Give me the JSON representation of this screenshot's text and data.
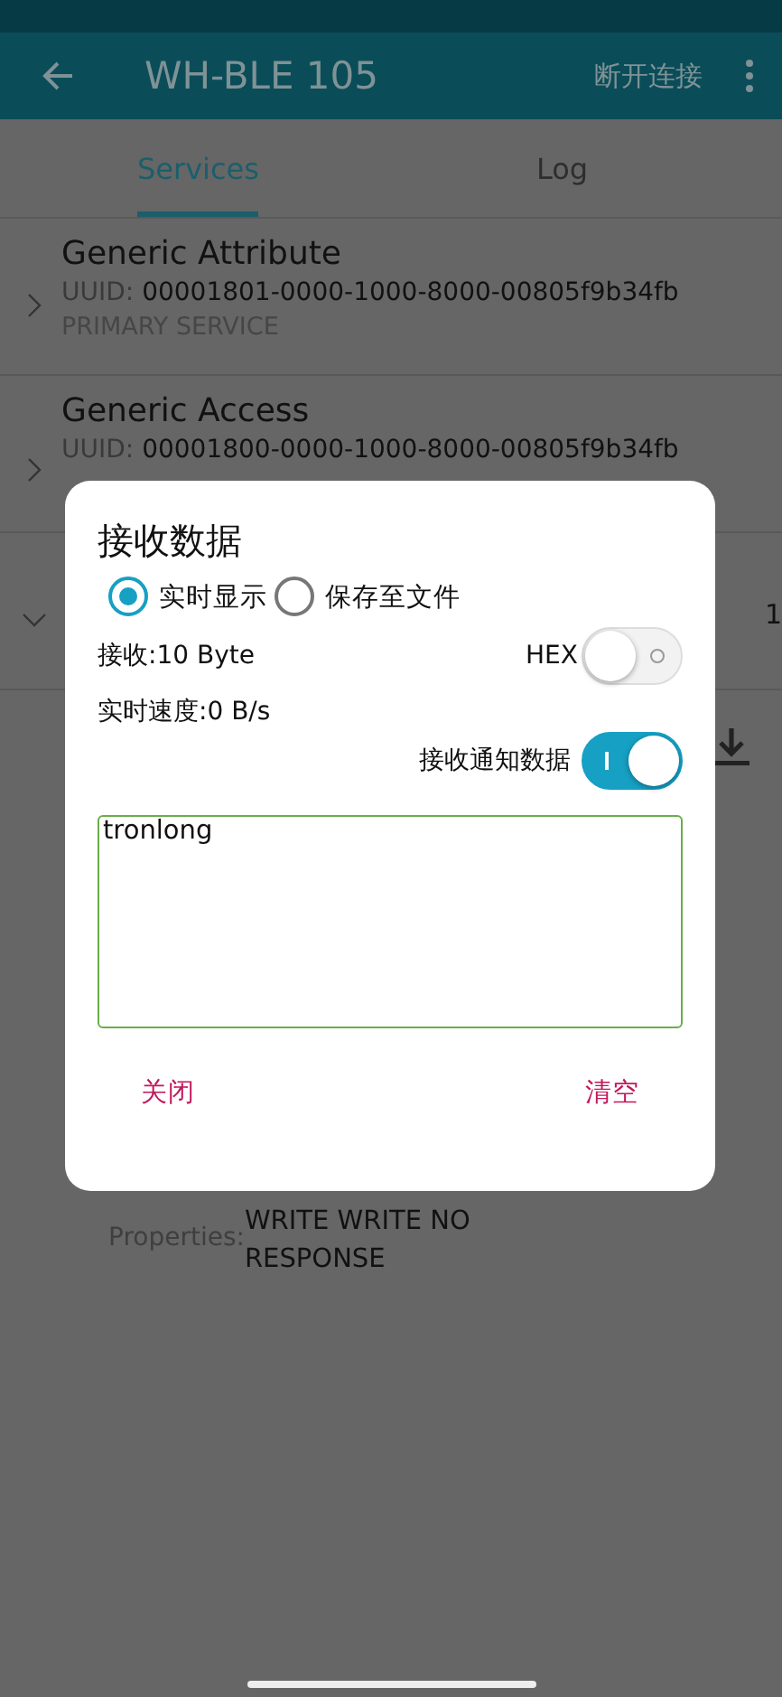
{
  "app_bar": {
    "title": "WH-BLE 105",
    "action": "断开连接"
  },
  "tabs": [
    {
      "label": "Services",
      "selected": true
    },
    {
      "label": "Log",
      "selected": false
    }
  ],
  "services": [
    {
      "name": "Generic Attribute",
      "uuid_label": "UUID:",
      "uuid": "00001801-0000-1000-8000-00805f9b34fb",
      "type": "PRIMARY SERVICE",
      "expanded": false
    },
    {
      "name": "Generic Access",
      "uuid_label": "UUID:",
      "uuid": "00001800-0000-1000-8000-00805f9b34fb",
      "expanded": false
    },
    {
      "fragment": "1",
      "expanded": true
    }
  ],
  "characteristic": {
    "properties_label": "Properties:",
    "properties": "WRITE WRITE NO RESPONSE"
  },
  "dialog": {
    "title": "接收数据",
    "modes": [
      {
        "label": "实时显示",
        "selected": true
      },
      {
        "label": "保存至文件",
        "selected": false
      }
    ],
    "received": "接收:10 Byte",
    "hex": {
      "label": "HEX",
      "on": false
    },
    "speed": "实时速度:0 B/s",
    "notify": {
      "label": "接收通知数据",
      "on": true
    },
    "output": "tronlong",
    "buttons": [
      "关闭",
      "清空"
    ]
  }
}
